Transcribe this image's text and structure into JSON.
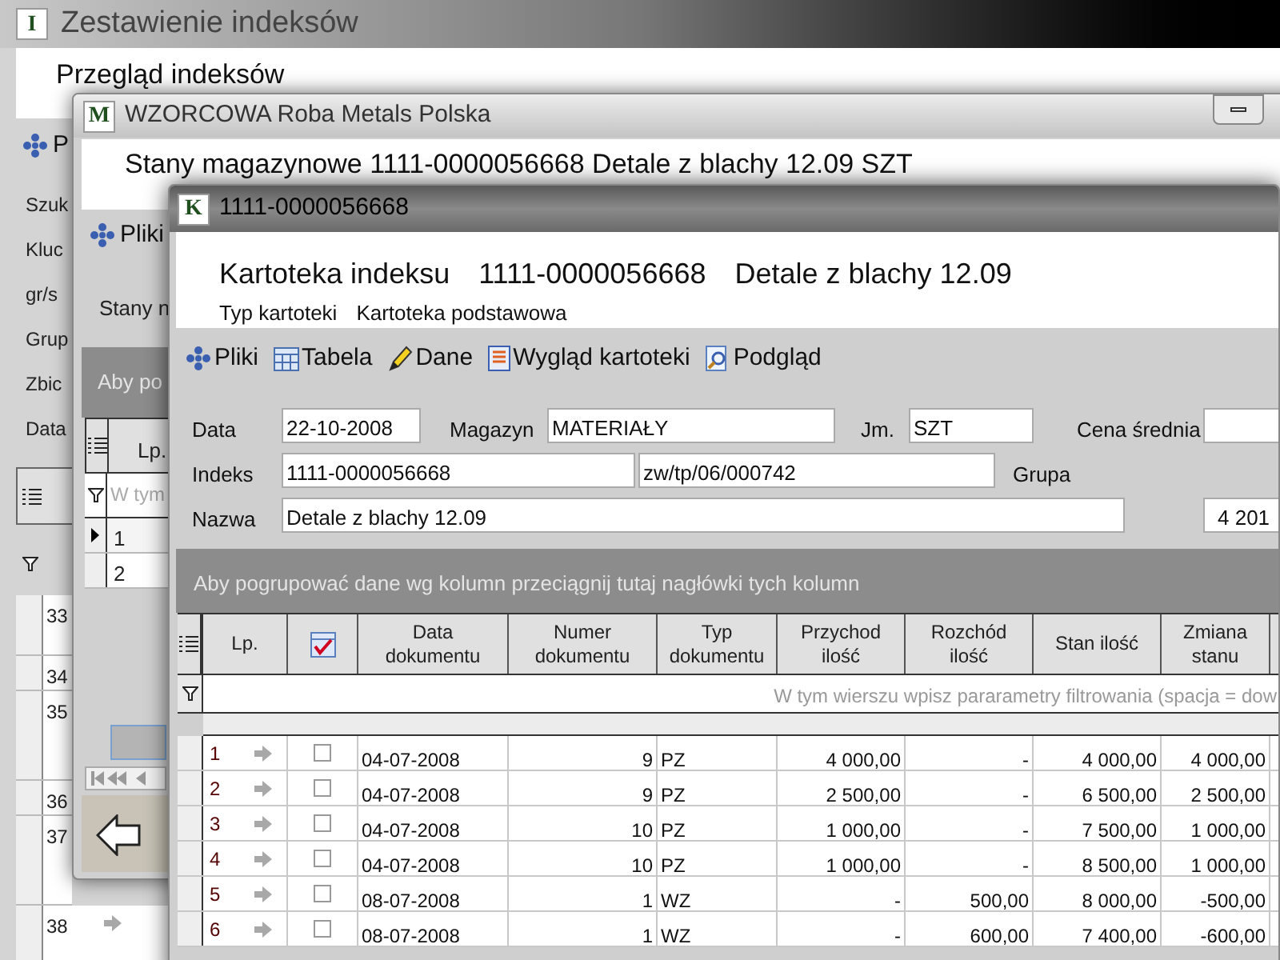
{
  "back_window": {
    "icon_letter": "I",
    "title": "Zestawienie indeksów",
    "heading": "Przegląd indeksów",
    "toolbar": [
      "P"
    ],
    "filter_labels": [
      "Szuk",
      "Kluc",
      "gr/s",
      "Grup",
      "Zbic",
      "Data"
    ],
    "rows": [
      "33",
      "34",
      "35",
      "36",
      "37",
      "38"
    ]
  },
  "middle_window": {
    "icon_letter": "M",
    "title": "WZORCOWA Roba Metals Polska",
    "heading": "Stany magazynowe 1111-0000056668 Detale z blachy 12.09 SZT",
    "toolbar": [
      "Pliki"
    ],
    "subheading": "Stany n",
    "group_hint": "Aby po",
    "columns": [
      "Lp."
    ],
    "filter_hint": "W tym",
    "rows": [
      {
        "lp": "1",
        "selected": true
      },
      {
        "lp": "2",
        "selected": false
      }
    ]
  },
  "front_window": {
    "icon_letter": "K",
    "title": "1111-0000056668",
    "heading": {
      "label": "Kartoteka indeksu",
      "code": "1111-0000056668",
      "name": "Detale z blachy 12.09"
    },
    "type_label": "Typ kartoteki",
    "type_value": "Kartoteka podstawowa",
    "toolbar": [
      {
        "kind": "files",
        "label": "Pliki"
      },
      {
        "kind": "table",
        "label": "Tabela"
      },
      {
        "kind": "edit",
        "label": "Dane"
      },
      {
        "kind": "layout",
        "label": "Wygląd kartoteki"
      },
      {
        "kind": "preview",
        "label": "Podgląd"
      }
    ],
    "form": {
      "date": {
        "label": "Data",
        "value": "22-10-2008"
      },
      "warehouse": {
        "label": "Magazyn",
        "value": "MATERIAŁY"
      },
      "unit": {
        "label": "Jm.",
        "value": "SZT"
      },
      "avg_price": {
        "label": "Cena średnia"
      },
      "index": {
        "label": "Indeks",
        "value": "1111-0000056668"
      },
      "code_value": "zw/tp/06/000742",
      "group": {
        "label": "Grupa"
      },
      "name": {
        "label": "Nazwa",
        "value": "Detale z blachy 12.09"
      },
      "number_value": "4 201"
    },
    "group_hint": "Aby pogrupować dane wg kolumn przeciągnij tutaj nagłówki tych kolumn",
    "columns": [
      "Lp.",
      "Data dokumentu",
      "Numer dokumentu",
      "Typ dokumentu",
      "Przychod ilość",
      "Rozchód ilość",
      "Stan ilość",
      "Zmiana stanu"
    ],
    "filter_hint": "W tym wierszu wpisz pararametry filtrowania (spacja = dow",
    "rows": [
      {
        "lp": "1",
        "checked": false,
        "date": "04-07-2008",
        "number": "9",
        "type": "PZ",
        "income": "4 000,00",
        "outcome": "-",
        "stock": "4 000,00",
        "change": "4 000,00"
      },
      {
        "lp": "2",
        "checked": false,
        "date": "04-07-2008",
        "number": "9",
        "type": "PZ",
        "income": "2 500,00",
        "outcome": "-",
        "stock": "6 500,00",
        "change": "2 500,00"
      },
      {
        "lp": "3",
        "checked": false,
        "date": "04-07-2008",
        "number": "10",
        "type": "PZ",
        "income": "1 000,00",
        "outcome": "-",
        "stock": "7 500,00",
        "change": "1 000,00"
      },
      {
        "lp": "4",
        "checked": false,
        "date": "04-07-2008",
        "number": "10",
        "type": "PZ",
        "income": "1 000,00",
        "outcome": "-",
        "stock": "8 500,00",
        "change": "1 000,00"
      },
      {
        "lp": "5",
        "checked": false,
        "date": "08-07-2008",
        "number": "1",
        "type": "WZ",
        "income": "-",
        "outcome": "500,00",
        "stock": "8 000,00",
        "change": "-500,00"
      },
      {
        "lp": "6",
        "checked": false,
        "date": "08-07-2008",
        "number": "1",
        "type": "WZ",
        "income": "-",
        "outcome": "600,00",
        "stock": "7 400,00",
        "change": "-600,00"
      }
    ]
  }
}
